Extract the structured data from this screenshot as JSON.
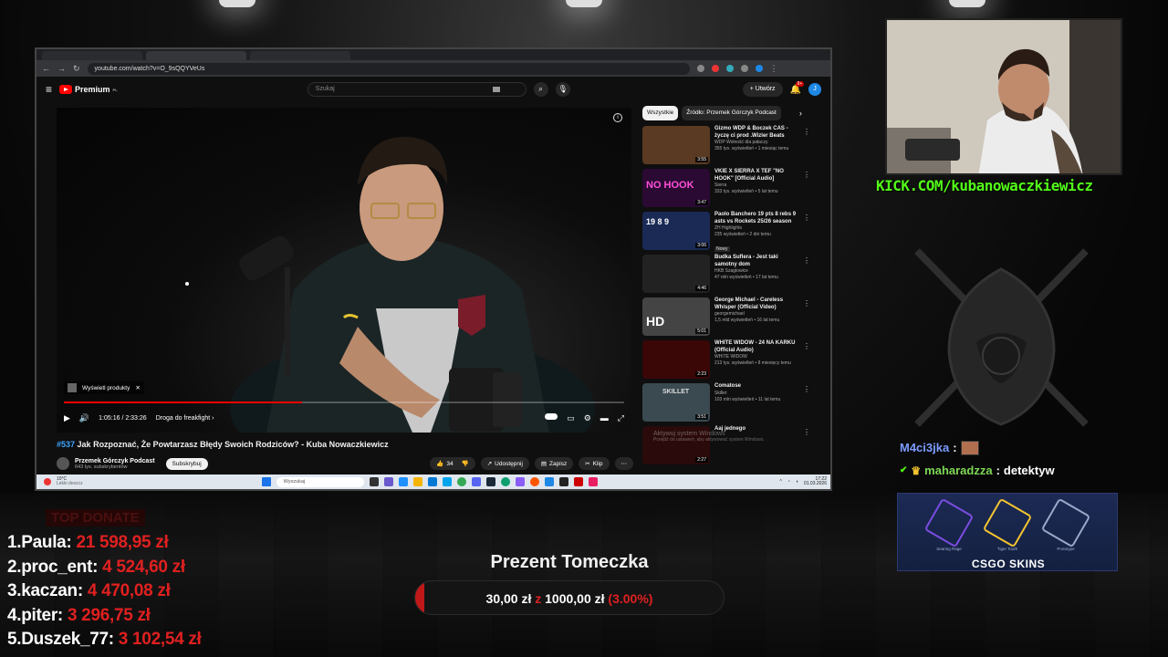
{
  "browser": {
    "url": "youtube.com/watch?v=O_9sQQYVeUs"
  },
  "youtube": {
    "logo_text": "Premium",
    "logo_sup": "PL",
    "search_placeholder": "Szukaj",
    "create_label": "Utwórz",
    "notif_count": "9+",
    "avatar_letter": "J"
  },
  "player": {
    "products_label": "Wyświetl produkty",
    "time": "1:05:16 / 2:33:26",
    "chapter": "Droga do freakfight",
    "progress": 0.425
  },
  "video": {
    "number": "#537",
    "title": "Jak Rozpoznać, Że Powtarzasz Błędy Swoich Rodziców? - Kuba Nowaczkiewicz",
    "channel": "Przemek Górczyk Podcast",
    "subscribers": "643 tys. subskrybentów",
    "subscribe_label": "Subskrybuj",
    "likes": "34",
    "share_label": "Udostępnij",
    "save_label": "Zapisz",
    "clip_label": "Klip"
  },
  "sidebar": {
    "chips": [
      "Wszystkie",
      "Źródło: Przemek Górczyk Podcast"
    ],
    "related": [
      {
        "title": "Gizmo WDP & Boczek CAS - życzę ci prod .Wizler Beats",
        "channel": "WDP Wolność dla pałaczy",
        "views": "355 tys. wyświetleń • 1 miesiąc temu",
        "duration": "3:55",
        "thumb": "#5a3a22",
        "badge": ""
      },
      {
        "title": "VKIE X SIERRA X TEF \"NO HOOK\" [Official Audio]",
        "channel": "Sierra",
        "views": "333 tys. wyświetleń • 5 lat temu",
        "duration": "3:47",
        "thumb": "#2a0a33",
        "badge": "",
        "thumb_text": "NO HOOK"
      },
      {
        "title": "Paolo Banchero 19 pts 8 rebs 9 asts vs Rockets 25/26 season",
        "channel": "ZH Highlights",
        "views": "235 wyświetleń • 2 dni temu",
        "duration": "3:06",
        "thumb": "#1a2a55",
        "badge": "Nowy",
        "thumb_text": "19 8 9"
      },
      {
        "title": "Budka Suflera - Jest taki samotny dom",
        "channel": "HKB Szaglowice",
        "views": "47 mln wyświetleń • 17 lat temu",
        "duration": "4:46",
        "thumb": "#222222",
        "badge": ""
      },
      {
        "title": "George Michael - Careless Whisper (Official Video)",
        "channel": "georgemichael",
        "views": "1,5 mld wyświetleń • 16 lat temu",
        "duration": "5:01",
        "thumb": "#444444",
        "badge": "",
        "thumb_text": "HD"
      },
      {
        "title": "WHITE WIDOW - 24 NA KARKU (Official Audio)",
        "channel": "WHITE WIDOW",
        "views": "213 tys. wyświetleń • 8 miesięcy temu",
        "duration": "2:23",
        "thumb": "#3a0606",
        "badge": ""
      },
      {
        "title": "Comatose",
        "channel": "Skillet",
        "views": "103 mln wyświetleń • 11 lat temu",
        "duration": "3:51",
        "thumb": "#3a4a50",
        "badge": "",
        "thumb_text": "SKILLET"
      },
      {
        "title": "Aaj jednego",
        "channel": "",
        "views": "",
        "duration": "2:27",
        "thumb": "#2a0a0a",
        "badge": ""
      }
    ],
    "activate_title": "Aktywuj system Windows",
    "activate_sub": "Przejdź do ustawień, aby aktywować system Windows."
  },
  "taskbar": {
    "temp": "10°C",
    "weather": "Lekki deszcz",
    "search": "Wyszukaj",
    "time": "17:22",
    "date": "01.03.2026"
  },
  "stream": {
    "kick_url": "KICK.COM/kubanowaczkiewicz",
    "chat": [
      {
        "user": "M4ci3jka",
        "message": ""
      },
      {
        "user": "maharadzza",
        "message": "detektyw"
      }
    ],
    "ad": {
      "brand": "CSGO SKINS",
      "items": [
        "Searing Rage",
        "Tiger Tooth",
        "Prototype"
      ]
    },
    "top_donate_label": "TOP DONATE",
    "donations": [
      {
        "rank": "1.",
        "name": "Paula:",
        "amount": "21 598,95 zł"
      },
      {
        "rank": "2.",
        "name": "proc_ent:",
        "amount": "4 524,60 zł"
      },
      {
        "rank": "3.",
        "name": "kaczan:",
        "amount": "4 470,08 zł"
      },
      {
        "rank": "4.",
        "name": "piter:",
        "amount": "3 296,75 zł"
      },
      {
        "rank": "5.",
        "name": "Duszek_77:",
        "amount": "3 102,54 zł"
      }
    ],
    "goal": {
      "title": "Prezent Tomeczka",
      "current": "30,00 zł",
      "separator": "z",
      "target": "1000,00 zł",
      "percent": "(3.00%)",
      "fraction": 0.03
    }
  },
  "colors": {
    "accent_red": "#e02020",
    "kick_green": "#53fc18",
    "yt_red": "#ff0000"
  }
}
